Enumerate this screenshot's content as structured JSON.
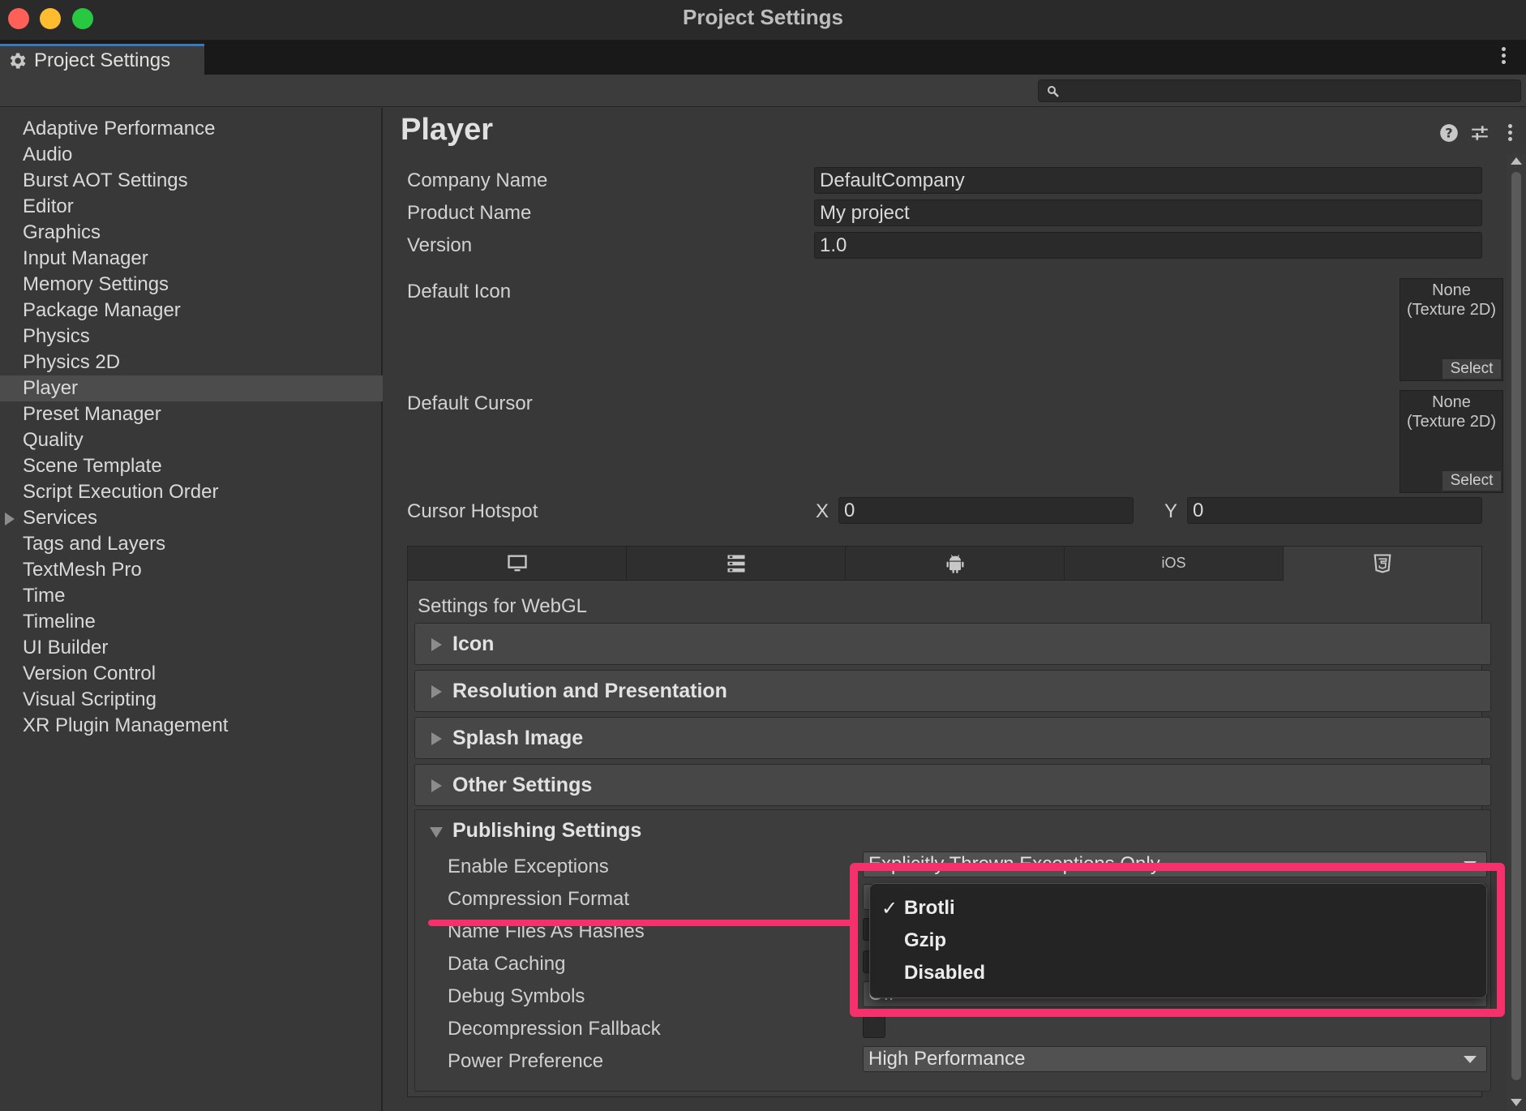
{
  "window": {
    "title": "Project Settings"
  },
  "tab": {
    "label": "Project Settings",
    "icon": "gear-icon"
  },
  "search": {
    "placeholder": ""
  },
  "sidebar": {
    "items": [
      {
        "label": "Adaptive Performance"
      },
      {
        "label": "Audio"
      },
      {
        "label": "Burst AOT Settings"
      },
      {
        "label": "Editor"
      },
      {
        "label": "Graphics"
      },
      {
        "label": "Input Manager"
      },
      {
        "label": "Memory Settings"
      },
      {
        "label": "Package Manager"
      },
      {
        "label": "Physics"
      },
      {
        "label": "Physics 2D"
      },
      {
        "label": "Player",
        "selected": true
      },
      {
        "label": "Preset Manager"
      },
      {
        "label": "Quality"
      },
      {
        "label": "Scene Template"
      },
      {
        "label": "Script Execution Order"
      },
      {
        "label": "Services",
        "expandable": true
      },
      {
        "label": "Tags and Layers"
      },
      {
        "label": "TextMesh Pro"
      },
      {
        "label": "Time"
      },
      {
        "label": "Timeline"
      },
      {
        "label": "UI Builder"
      },
      {
        "label": "Version Control"
      },
      {
        "label": "Visual Scripting"
      },
      {
        "label": "XR Plugin Management"
      }
    ]
  },
  "player": {
    "title": "Player",
    "company_name_label": "Company Name",
    "company_name": "DefaultCompany",
    "product_name_label": "Product Name",
    "product_name": "My project",
    "version_label": "Version",
    "version": "1.0",
    "default_icon_label": "Default Icon",
    "default_cursor_label": "Default Cursor",
    "object_none": "None\n(Texture 2D)",
    "select_label": "Select",
    "cursor_hotspot_label": "Cursor Hotspot",
    "hotspot_x_label": "X",
    "hotspot_x": "0",
    "hotspot_y_label": "Y",
    "hotspot_y": "0"
  },
  "platform_tabs": [
    {
      "icon": "desktop-icon"
    },
    {
      "icon": "server-icon"
    },
    {
      "icon": "android-icon"
    },
    {
      "label": "iOS"
    },
    {
      "icon": "html5-icon",
      "active": true
    }
  ],
  "webgl": {
    "settings_for": "Settings for WebGL",
    "sections": [
      {
        "label": "Icon"
      },
      {
        "label": "Resolution and Presentation"
      },
      {
        "label": "Splash Image"
      },
      {
        "label": "Other Settings"
      }
    ],
    "publishing": {
      "label": "Publishing Settings",
      "enable_exceptions_label": "Enable Exceptions",
      "enable_exceptions_value": "Explicitly Thrown Exceptions Only",
      "compression_format_label": "Compression Format",
      "name_files_label": "Name Files As Hashes",
      "data_caching_label": "Data Caching",
      "debug_symbols_label": "Debug Symbols",
      "debug_symbols_value": "Off",
      "decompression_fallback_label": "Decompression Fallback",
      "power_preference_label": "Power Preference",
      "power_preference_value": "High Performance"
    }
  },
  "compression_popup": {
    "options": [
      "Brotli",
      "Gzip",
      "Disabled"
    ],
    "selected": "Brotli",
    "check": "✓"
  },
  "colors": {
    "accent": "#3a79bb",
    "highlight": "#f6306a"
  }
}
